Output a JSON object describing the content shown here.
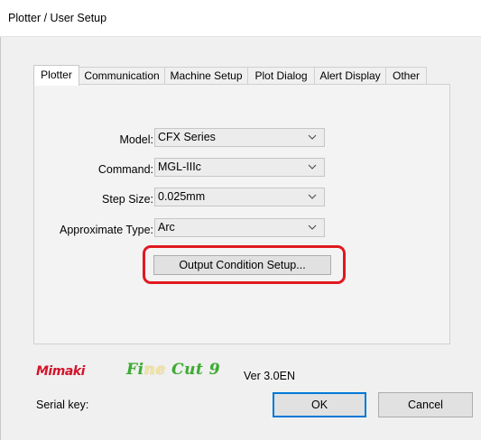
{
  "window": {
    "title": "Plotter / User Setup"
  },
  "tabs": [
    {
      "label": "Plotter",
      "active": true
    },
    {
      "label": "Communication",
      "active": false
    },
    {
      "label": "Machine Setup",
      "active": false
    },
    {
      "label": "Plot Dialog",
      "active": false
    },
    {
      "label": "Alert Display",
      "active": false
    },
    {
      "label": "Other",
      "active": false
    }
  ],
  "form": {
    "model": {
      "label": "Model:",
      "value": "CFX Series"
    },
    "command": {
      "label": "Command:",
      "value": "MGL-IIIc"
    },
    "step_size": {
      "label": "Step Size:",
      "value": "0.025mm"
    },
    "approximate_type": {
      "label": "Approximate Type:",
      "value": "Arc"
    },
    "output_condition_button": "Output Condition Setup..."
  },
  "footer": {
    "brand_logo": "Mimaki",
    "product_logo_pre": "Fi",
    "product_logo_mark": "ne",
    "product_logo_post": " Cut 9",
    "version": "Ver 3.0EN",
    "serial_label": "Serial key:",
    "ok_label": "OK",
    "cancel_label": "Cancel"
  },
  "colors": {
    "highlight": "#e0181f",
    "brand_red": "#d4142b",
    "finecut_green": "#3eaa35",
    "default_button_border": "#0078d7"
  },
  "icons": {
    "dropdown": "chevron-down-icon"
  }
}
